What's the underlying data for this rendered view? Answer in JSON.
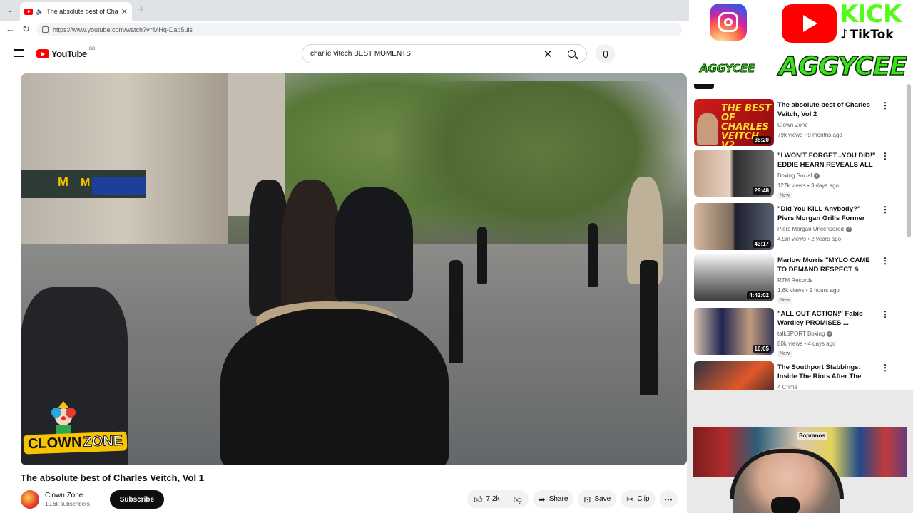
{
  "browser": {
    "tab_title": "The absolute best of Charles",
    "url": "https://www.youtube.com/watch?v=MHq-Dap5uls"
  },
  "youtube": {
    "logo_text": "YouTube",
    "country_code": "GB",
    "search_value": "charlie vitech BEST MOMENTS",
    "video": {
      "title": "The absolute best of Charles Veitch, Vol 1",
      "overlay_logo_left": "CLOWN",
      "overlay_logo_right": "ZONE"
    },
    "channel": {
      "name": "Clown Zone",
      "subscribers": "10.6k subscribers",
      "subscribe_label": "Subscribe"
    },
    "actions": {
      "likes": "7.2k",
      "share": "Share",
      "save": "Save",
      "clip": "Clip"
    },
    "recommendations": [
      {
        "thumb_text": "THE BEST OF CHARLES VEITCH V2",
        "title": "The absolute best of Charles Veitch, Vol 2",
        "channel": "Clown Zone",
        "verified": false,
        "meta": "79k views • 9 months ago",
        "duration": "35:20",
        "new": false
      },
      {
        "title": "\"I WON'T FORGET...YOU DID!\" EDDIE HEARN REVEALS ALL O...",
        "channel": "Boxing Social",
        "verified": true,
        "meta": "127k views • 3 days ago",
        "duration": "29:48",
        "new": true
      },
      {
        "title": "\"Did You KILL Anybody?\" Piers Morgan Grills Former Mafia ...",
        "channel": "Piers Morgan Uncensored",
        "verified": true,
        "meta": "4.9m views • 2 years ago",
        "duration": "43:17",
        "new": false
      },
      {
        "title": "Marlow Morris \"MYLO CAME TO DEMAND RESPECT & DROP ...",
        "channel": "RTM Records",
        "verified": false,
        "meta": "1.6k views • 9 hours ago",
        "duration": "4:42:02",
        "new": true
      },
      {
        "title": "\"ALL OUT ACTION!\" Fabio Wardley PROMISES ...",
        "channel": "talkSPORT Boxing",
        "verified": true,
        "meta": "80k views • 4 days ago",
        "duration": "16:05",
        "new": true
      },
      {
        "title": "The Southport Stabbings: Inside The Riots After The Mass ...",
        "channel": "4 Crime",
        "verified": false,
        "meta": "",
        "duration": "",
        "new": false
      }
    ],
    "new_badge": "New"
  },
  "overlay": {
    "kick": "KICK",
    "tiktok": "TikTok",
    "handle_small": "AGGYCEE",
    "handle_big": "AGGYCEE",
    "poster_text": "Sopranos"
  }
}
